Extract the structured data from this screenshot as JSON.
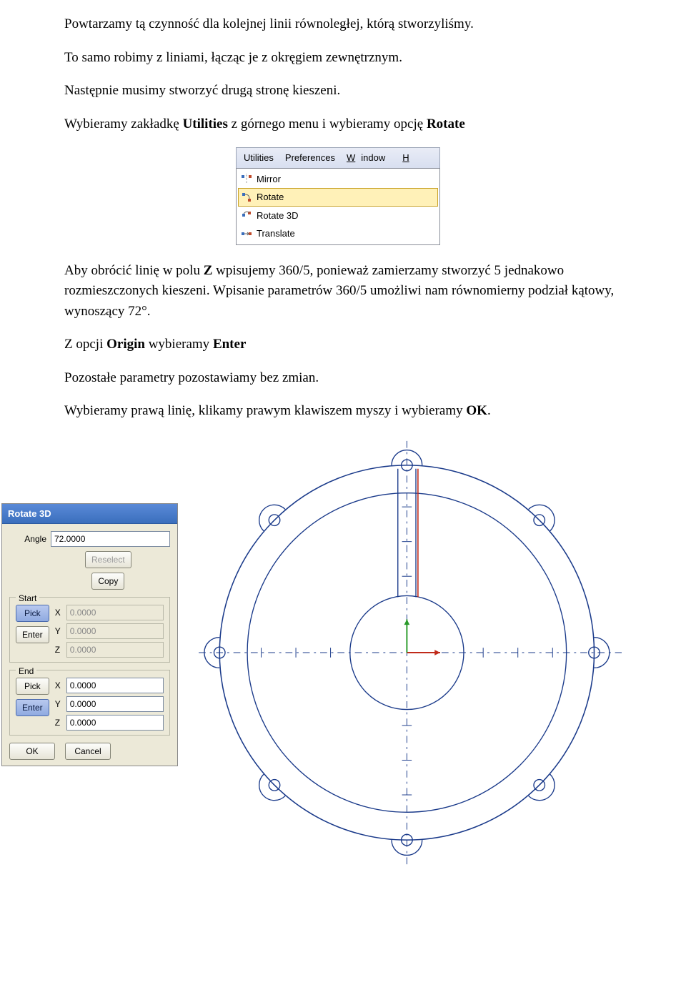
{
  "paragraphs": {
    "p1": "Powtarzamy tą czynność dla kolejnej linii równoległej, którą stworzyliśmy.",
    "p2": "To samo robimy z liniami, łącząc je z okręgiem zewnętrznym.",
    "p3": "Następnie musimy stworzyć drugą stronę kieszeni.",
    "p4_a": "Wybieramy zakładkę ",
    "p4_b": "Utilities",
    "p4_c": " z górnego menu i wybieramy opcję ",
    "p4_d": "Rotate",
    "p5_a": "Aby obrócić linię w polu ",
    "p5_b": "Z",
    "p5_c": " wpisujemy 360/5, ponieważ zamierzamy stworzyć 5 jednakowo rozmieszczonych kieszeni. Wpisanie parametrów 360/5 umożliwi nam równomierny podział kątowy, wynoszący 72°.",
    "p6_a": "Z opcji ",
    "p6_b": "Origin",
    "p6_c": " wybieramy ",
    "p6_d": "Enter",
    "p7": "Pozostałe parametry pozostawiamy bez zmian.",
    "p8_a": "Wybieramy prawą linię, klikamy prawym klawiszem myszy i wybieramy ",
    "p8_b": "OK",
    "p8_c": "."
  },
  "menu": {
    "top": {
      "utilities": "Utilities",
      "preferences": "Preferences",
      "window_pre": "W",
      "window_rest": "indow",
      "h": "H"
    },
    "items": {
      "mirror": "Mirror",
      "rotate": "Rotate",
      "rotate3d": "Rotate 3D",
      "translate": "Translate"
    }
  },
  "dialog": {
    "title": "Rotate 3D",
    "angle_label": "Angle",
    "angle_value": "72.0000",
    "reselect": "Reselect",
    "copy": "Copy",
    "start_label": "Start",
    "end_label": "End",
    "pick": "Pick",
    "enter": "Enter",
    "x": "X",
    "y": "Y",
    "z": "Z",
    "start_x": "0.0000",
    "start_y": "0.0000",
    "start_z": "0.0000",
    "end_x": "0.0000",
    "end_y": "0.0000",
    "end_z": "0.0000",
    "ok": "OK",
    "cancel": "Cancel"
  }
}
